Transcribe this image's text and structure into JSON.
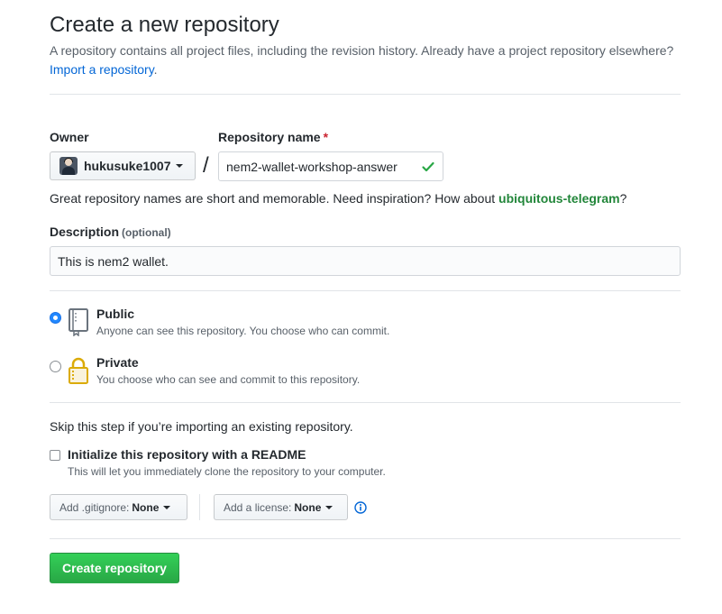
{
  "header": {
    "title": "Create a new repository",
    "description_before": "A repository contains all project files, including the revision history. Already have a project repository elsewhere? ",
    "import_link": "Import a repository",
    "description_after": "."
  },
  "owner": {
    "label": "Owner",
    "value": "hukusuke1007"
  },
  "repo_name": {
    "label": "Repository name",
    "required_mark": "*",
    "separator": "/",
    "value": "nem2-wallet-workshop-answer",
    "valid": true
  },
  "hint": {
    "text": "Great repository names are short and memorable. Need inspiration? How about ",
    "suggestion": "ubiquitous-telegram",
    "suffix": "?"
  },
  "description_field": {
    "label": "Description",
    "optional": "(optional)",
    "value": "This is nem2 wallet."
  },
  "visibility": {
    "selected": "public",
    "options": [
      {
        "title": "Public",
        "note": "Anyone can see this repository. You choose who can commit."
      },
      {
        "title": "Private",
        "note": "You choose who can see and commit to this repository."
      }
    ]
  },
  "init": {
    "skip_text": "Skip this step if you’re importing an existing repository.",
    "readme_label": "Initialize this repository with a README",
    "readme_note": "This will let you immediately clone the repository to your computer.",
    "readme_checked": false
  },
  "gitignore": {
    "label": "Add .gitignore:",
    "value": "None"
  },
  "license": {
    "label": "Add a license:",
    "value": "None"
  },
  "submit": {
    "label": "Create repository"
  },
  "colors": {
    "link": "#0366d6",
    "success": "#28a745",
    "suggestion": "#22863a",
    "required": "#cb2431",
    "radio_selected": "#2188ff"
  }
}
